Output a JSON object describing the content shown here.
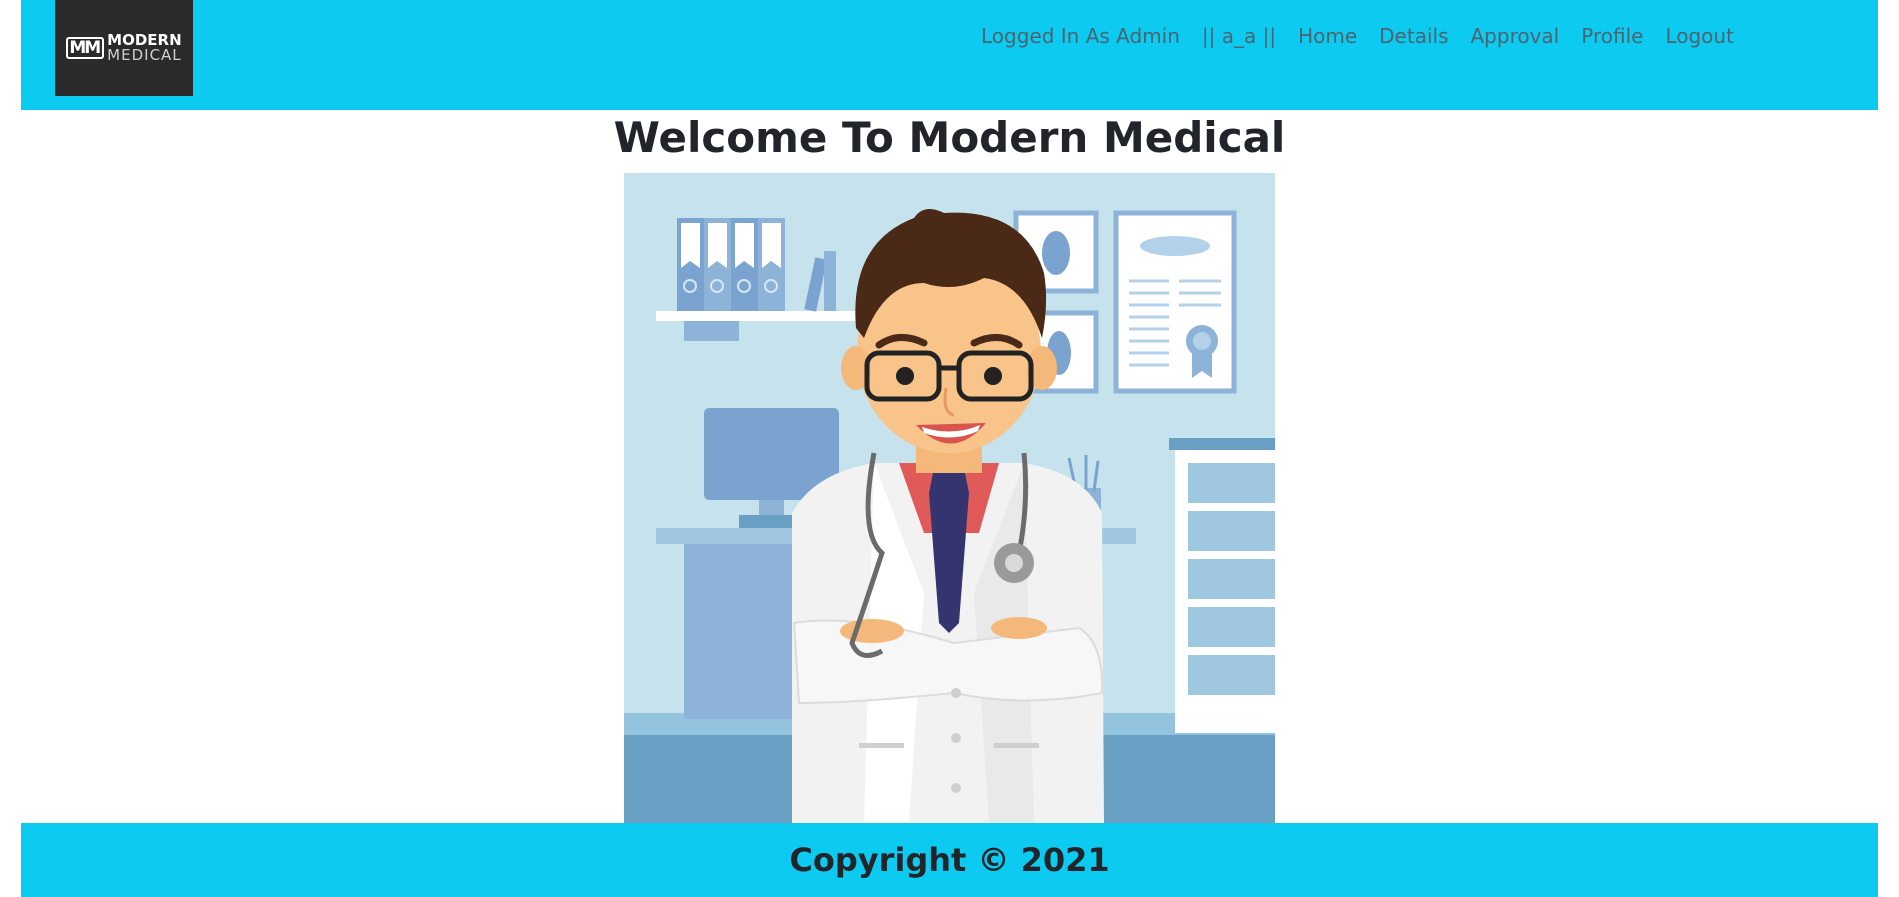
{
  "colors": {
    "navbar_bg": "#0dcaf0",
    "nav_text": "#4a6570",
    "heading_text": "#212529",
    "logo_bg": "#2a2a2a"
  },
  "brand": {
    "mark": "MM",
    "line1": "MODERN",
    "line2": "MEDICAL",
    "icon": "modern-medical-logo"
  },
  "nav": {
    "status": "Logged In As Admin",
    "user": "|| a_a ||",
    "links": [
      "Home",
      "Details",
      "Approval",
      "Profile",
      "Logout"
    ]
  },
  "main": {
    "heading": "Welcome To Modern Medical",
    "illustration_icon": "doctor-illustration"
  },
  "footer": {
    "copyright": "Copyright © 2021"
  }
}
